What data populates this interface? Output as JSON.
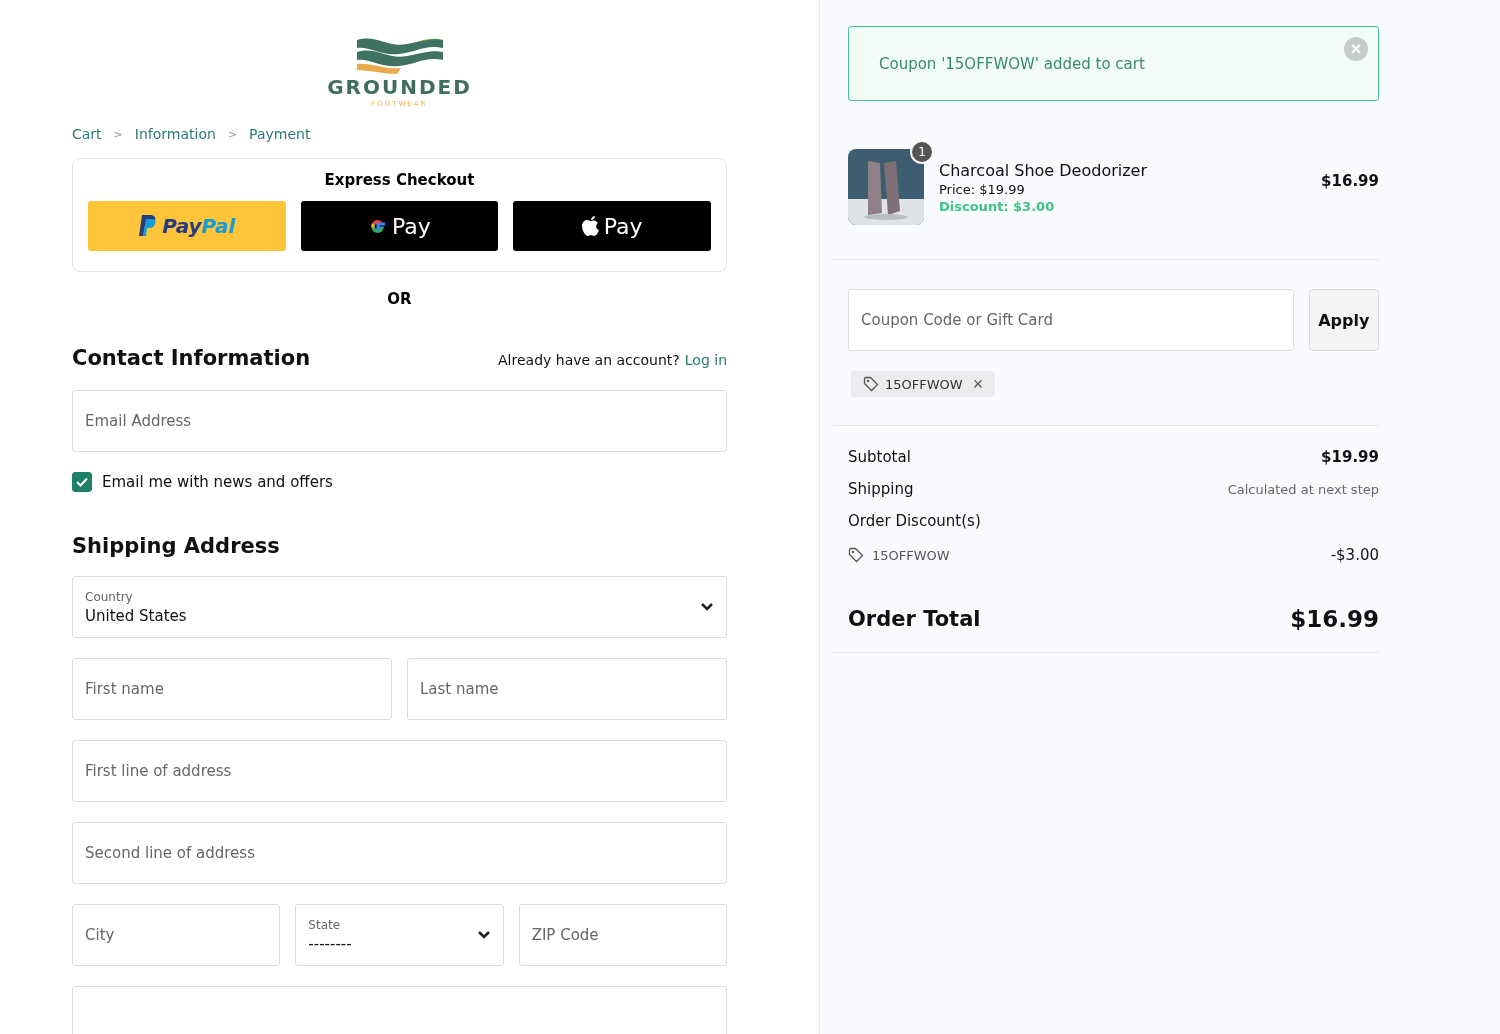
{
  "logo": {
    "name": "GROUNDED",
    "tagline": "FOOTWEAR"
  },
  "breadcrumbs": [
    {
      "label": "Cart",
      "separator": ">"
    },
    {
      "label": "Information",
      "separator": ">"
    },
    {
      "label": "Payment"
    }
  ],
  "express_checkout": {
    "title": "Express Checkout",
    "buttons": [
      {
        "kind": "paypal",
        "label_a": "Pay",
        "label_b": "Pal"
      },
      {
        "kind": "gpay",
        "label": "Pay"
      },
      {
        "kind": "applepay",
        "label": "Pay"
      }
    ]
  },
  "divider_text": "OR",
  "contact": {
    "title": "Contact Information",
    "account_prompt": "Already have an account?",
    "login_link": "Log in",
    "email": {
      "placeholder": "Email Address"
    },
    "newsletter": {
      "label": "Email me with news and offers",
      "checked": true
    }
  },
  "shipping": {
    "title": "Shipping Address",
    "country": {
      "label": "Country",
      "value": "United States"
    },
    "first_name": {
      "placeholder": "First name"
    },
    "last_name": {
      "placeholder": "Last name"
    },
    "address1": {
      "placeholder": "First line of address"
    },
    "address2": {
      "placeholder": "Second line of address"
    },
    "city": {
      "placeholder": "City"
    },
    "state": {
      "label": "State",
      "value": "--------"
    },
    "zip": {
      "placeholder": "ZIP Code"
    }
  },
  "notice": {
    "message": "Coupon '15OFFWOW' added to cart",
    "close": "×"
  },
  "cart_item": {
    "quantity": "1",
    "name": "Charcoal Shoe Deodorizer",
    "price": "Price: $19.99",
    "discount": "Discount: $3.00",
    "total": "$16.99"
  },
  "coupon": {
    "placeholder": "Coupon Code or Gift Card",
    "button": "Apply",
    "applied": [
      {
        "code": "15OFFWOW",
        "remove": "×"
      }
    ]
  },
  "summary": {
    "rows": [
      {
        "kind": "line",
        "label": "Subtotal",
        "value": "$19.99"
      },
      {
        "kind": "note",
        "label": "Shipping",
        "value": "Calculated at next step"
      },
      {
        "kind": "heading",
        "label": "Order Discount(s)"
      },
      {
        "kind": "discount",
        "label": "15OFFWOW",
        "value": "-$3.00"
      }
    ],
    "total": {
      "label": "Order Total",
      "value": "$16.99"
    }
  }
}
